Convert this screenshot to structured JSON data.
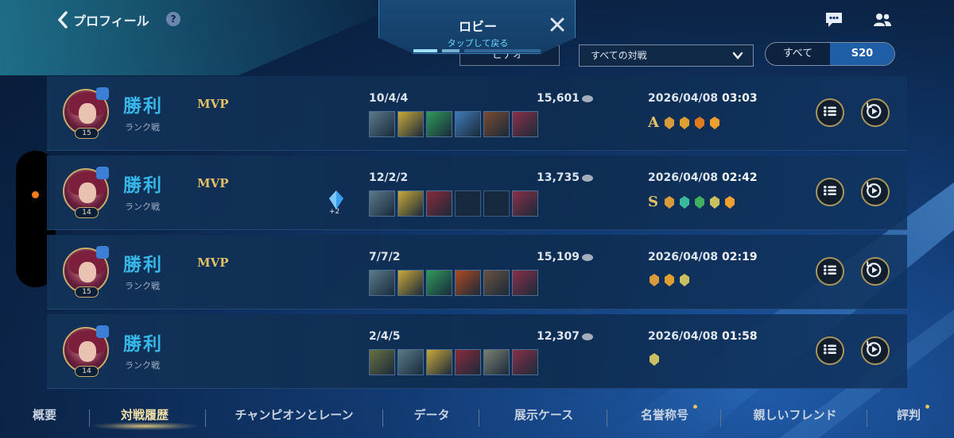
{
  "topbar": {
    "back_label": "プロフィール",
    "help_symbol": "?",
    "lobby_title": "ロビー",
    "lobby_subtitle": "タップして戻る",
    "video_label": "ビデオ",
    "filter_value": "すべての対戦",
    "season_options": [
      "すべて",
      "S20"
    ],
    "season_selected": "S20"
  },
  "icons": {
    "back": "chevron-left-icon",
    "help": "question-icon",
    "close": "close-icon",
    "chat": "chat-icon",
    "friends": "friends-icon",
    "detail": "list-icon",
    "replay": "replay-icon"
  },
  "colors": {
    "victory": "#36b7e8",
    "mvp": "#e2c166",
    "accent_gold": "#aa965c",
    "active_toggle": "#1f5fa8",
    "side_dot": "#f07d1a"
  },
  "matches": [
    {
      "result": "勝利",
      "queue": "ランク戦",
      "level": "15",
      "mvp": "MVP",
      "kda": "10/4/4",
      "gold": "15,601",
      "date": "2026/04/08",
      "time": "03:03",
      "grade": "A",
      "crystal_count": ""
    },
    {
      "result": "勝利",
      "queue": "ランク戦",
      "level": "14",
      "mvp": "MVP",
      "kda": "12/2/2",
      "gold": "13,735",
      "date": "2026/04/08",
      "time": "02:42",
      "grade": "S",
      "crystal_count": "+2"
    },
    {
      "result": "勝利",
      "queue": "ランク戦",
      "level": "15",
      "mvp": "MVP",
      "kda": "7/7/2",
      "gold": "15,109",
      "date": "2026/04/08",
      "time": "02:19",
      "grade": "",
      "crystal_count": ""
    },
    {
      "result": "勝利",
      "queue": "ランク戦",
      "level": "14",
      "mvp": "",
      "kda": "2/4/5",
      "gold": "12,307",
      "date": "2026/04/08",
      "time": "01:58",
      "grade": "",
      "crystal_count": ""
    }
  ],
  "bottom_nav": {
    "tabs": [
      "概要",
      "対戦履歴",
      "チャンピオンとレーン",
      "データ",
      "展示ケース",
      "名誉称号",
      "親しいフレンド",
      "評判"
    ],
    "active": "対戦履歴"
  }
}
